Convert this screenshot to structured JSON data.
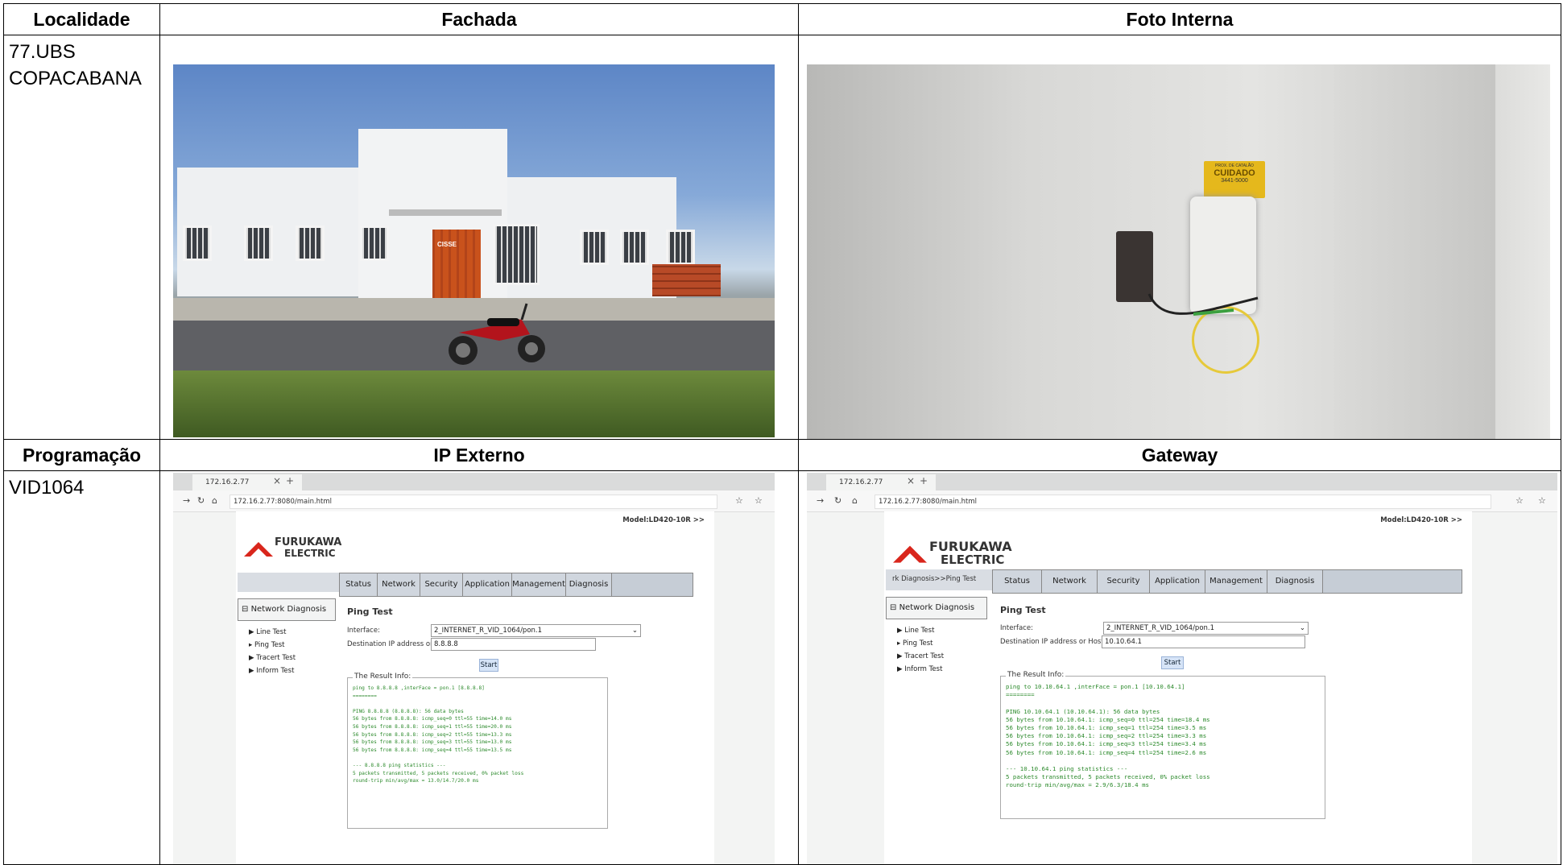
{
  "headers": {
    "localidade": "Localidade",
    "fachada": "Fachada",
    "foto_interna": "Foto Interna",
    "programacao": "Programação",
    "ip_externo": "IP Externo",
    "gateway": "Gateway"
  },
  "localidade": {
    "line1": "77.UBS",
    "line2": "COPACABANA"
  },
  "programacao": {
    "value": "VID1064"
  },
  "photos": {
    "container_text": "CISSE",
    "tag_line1": "PROX. DE CATALÃO",
    "tag_line2": "CUIDADO",
    "tag_line3": "3441-5000"
  },
  "browser": {
    "tab_title": "172.16.2.77",
    "model": "Model:LD420-10R >>",
    "logo_line1": "FURUKAWA",
    "logo_line2": "ELECTRIC",
    "menu": [
      "Status",
      "Network",
      "Security",
      "Application",
      "Management",
      "Diagnosis"
    ],
    "side_head": "Network Diagnosis",
    "side_items": [
      "Line Test",
      "Ping Test",
      "Tracert Test",
      "Inform Test"
    ],
    "page_title": "Ping Test",
    "interface_label": "Interface:",
    "interface_value": "2_INTERNET_R_VID_1064/pon.1",
    "dest_label": "Destination IP address or Host Name:",
    "start": "Start",
    "result_title": "The Result Info:"
  },
  "ip_externo": {
    "url": "172.16.2.77:8080/main.html",
    "crumb": "",
    "dest_value": "8.8.8.8",
    "result": "ping to 8.8.8.8 ,interFace = pon.1 [8.8.8.8]\n========\n\nPING 8.8.8.8 (8.8.8.8): 56 data bytes\n56 bytes from 8.8.8.8: icmp_seq=0 ttl=55 time=14.0 ms\n56 bytes from 8.8.8.8: icmp_seq=1 ttl=55 time=20.0 ms\n56 bytes from 8.8.8.8: icmp_seq=2 ttl=55 time=13.3 ms\n56 bytes from 8.8.8.8: icmp_seq=3 ttl=55 time=13.0 ms\n56 bytes from 8.8.8.8: icmp_seq=4 ttl=55 time=13.5 ms\n\n--- 8.8.8.8 ping statistics ---\n5 packets transmitted, 5 packets received, 0% packet loss\nround-trip min/avg/max = 13.0/14.7/20.0 ms"
  },
  "gateway": {
    "url": "172.16.2.77:8080/main.html",
    "crumb": "rk Diagnosis>>Ping Test",
    "dest_value": "10.10.64.1",
    "result": "ping to 10.10.64.1 ,interFace = pon.1 [10.10.64.1]\n========\n\nPING 10.10.64.1 (10.10.64.1): 56 data bytes\n56 bytes from 10.10.64.1: icmp_seq=0 ttl=254 time=18.4 ms\n56 bytes from 10.10.64.1: icmp_seq=1 ttl=254 time=3.5 ms\n56 bytes from 10.10.64.1: icmp_seq=2 ttl=254 time=3.3 ms\n56 bytes from 10.10.64.1: icmp_seq=3 ttl=254 time=3.4 ms\n56 bytes from 10.10.64.1: icmp_seq=4 ttl=254 time=2.6 ms\n\n--- 10.10.64.1 ping statistics ---\n5 packets transmitted, 5 packets received, 0% packet loss\nround-trip min/avg/max = 2.9/6.3/18.4 ms"
  },
  "colors": {
    "logo_red": "#d9261c",
    "result_green": "#2c8a2c",
    "menu_bg": "#c6cdd6"
  }
}
